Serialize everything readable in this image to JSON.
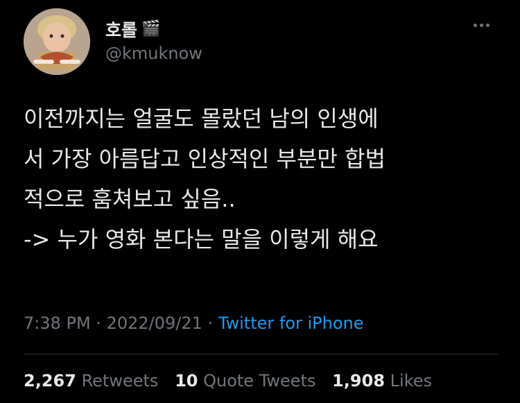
{
  "user": {
    "display_name": "호롤",
    "name_emoji": "🎬",
    "handle": "@kmuknow",
    "avatar_icon": "profile-photo-icon"
  },
  "more_icon": "more-options-icon",
  "tweet": {
    "lines": [
      "이전까지는 얼굴도 몰랐던 남의 인생에",
      "서 가장 아름답고 인상적인 부분만 합법",
      "적으로 훔쳐보고 싶음..",
      "-> 누가 영화 본다는 말을 이렇게 해요"
    ]
  },
  "meta": {
    "time": "7:38 PM",
    "sep1": " · ",
    "date": "2022/09/21",
    "sep2": " · ",
    "source": "Twitter for iPhone"
  },
  "stats": {
    "retweets_count": "2,267",
    "retweets_label": "Retweets",
    "quotes_count": "10",
    "quotes_label": "Quote Tweets",
    "likes_count": "1,908",
    "likes_label": "Likes"
  },
  "colors": {
    "background": "#000000",
    "text": "#e7e9ea",
    "muted": "#71767b",
    "link": "#1d9bf0"
  }
}
